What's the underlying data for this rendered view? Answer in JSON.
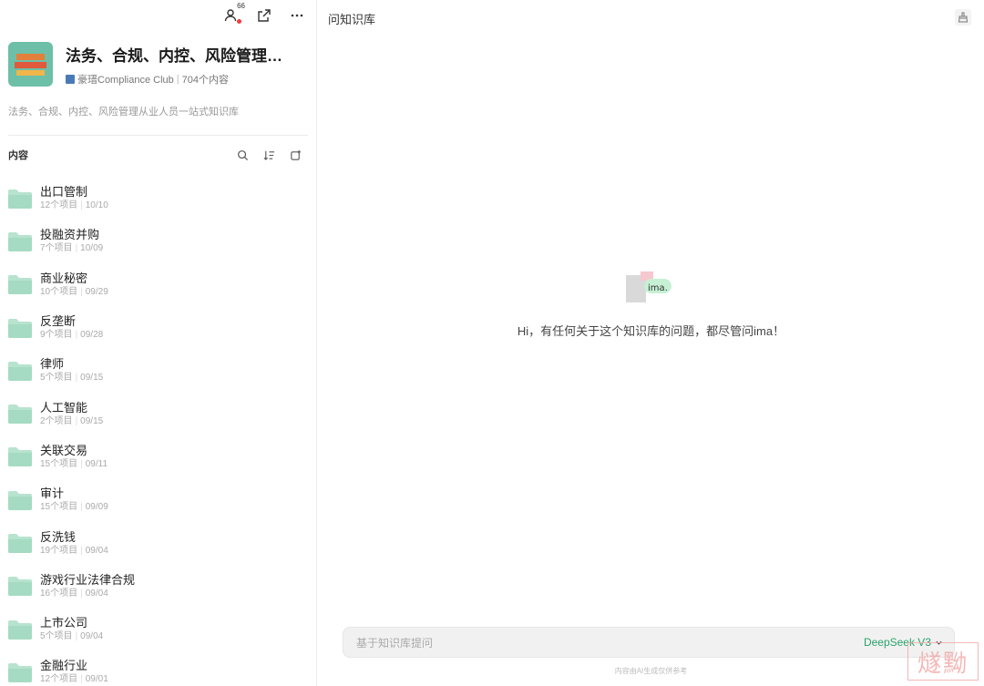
{
  "topbar": {
    "members_badge": "66",
    "members_icon": "members-icon",
    "share_icon": "share-icon",
    "more_icon": "more-icon"
  },
  "kb": {
    "title": "法务、合规、内控、风险管理…",
    "owner": "豪瑨Compliance Club",
    "count": "704个内容",
    "description": "法务、合规、内控、风险管理从业人员一站式知识库"
  },
  "content_section": {
    "title": "内容",
    "tools": [
      "search-icon",
      "sort-icon",
      "add-folder-icon"
    ]
  },
  "folders": [
    {
      "name": "出口管制",
      "count": "12个项目",
      "date": "10/10"
    },
    {
      "name": "投融资并购",
      "count": "7个项目",
      "date": "10/09"
    },
    {
      "name": "商业秘密",
      "count": "10个项目",
      "date": "09/29"
    },
    {
      "name": "反垄断",
      "count": "9个项目",
      "date": "09/28"
    },
    {
      "name": "律师",
      "count": "5个项目",
      "date": "09/15"
    },
    {
      "name": "人工智能",
      "count": "2个项目",
      "date": "09/15"
    },
    {
      "name": "关联交易",
      "count": "15个项目",
      "date": "09/11"
    },
    {
      "name": "审计",
      "count": "15个项目",
      "date": "09/09"
    },
    {
      "name": "反洗钱",
      "count": "19个项目",
      "date": "09/04"
    },
    {
      "name": "游戏行业法律合规",
      "count": "16个项目",
      "date": "09/04"
    },
    {
      "name": "上市公司",
      "count": "5个项目",
      "date": "09/04"
    },
    {
      "name": "金融行业",
      "count": "12个项目",
      "date": "09/01"
    }
  ],
  "chat": {
    "title": "问知识库",
    "logo_text": "ima.",
    "greeting": "Hi，有任何关于这个知识库的问题，都尽管问ima！",
    "input_placeholder": "基于知识库提问",
    "model": "DeepSeek V3",
    "footnote": "内容由AI生成仅供参考"
  },
  "watermark": "燧黝",
  "colors": {
    "accent_green": "#2aa36b",
    "folder_green": "#a9dcc6",
    "badge_red": "#f23c3c"
  }
}
